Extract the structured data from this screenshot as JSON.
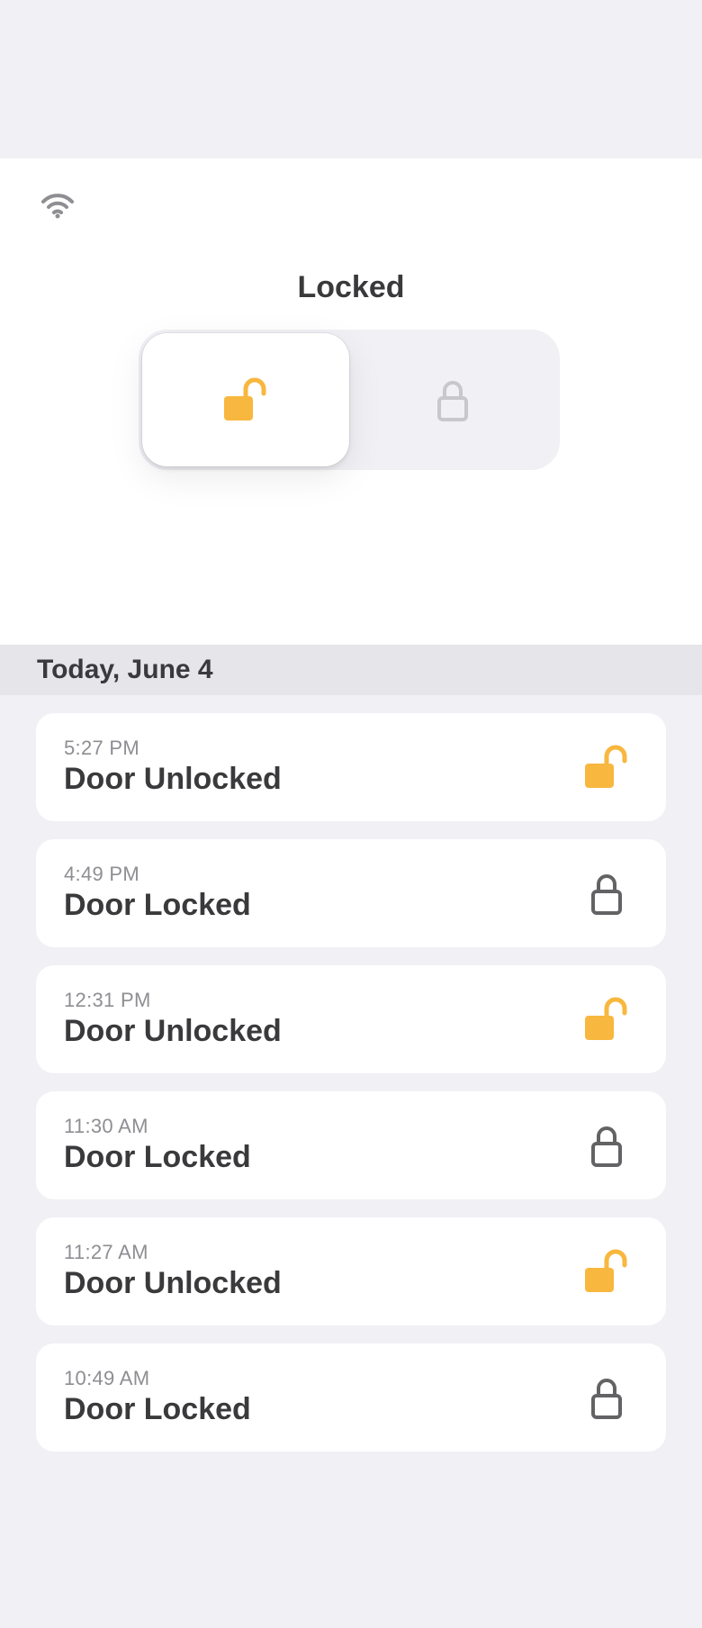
{
  "status": {
    "title": "Locked"
  },
  "toggle": {
    "unlock_icon": "unlocked-padlock-icon",
    "lock_icon": "locked-padlock-icon",
    "selected": "unlock"
  },
  "history": {
    "date_label": "Today, June 4",
    "events": [
      {
        "time": "5:27 PM",
        "label": "Door Unlocked",
        "state": "unlocked"
      },
      {
        "time": "4:49 PM",
        "label": "Door Locked",
        "state": "locked"
      },
      {
        "time": "12:31 PM",
        "label": "Door Unlocked",
        "state": "unlocked"
      },
      {
        "time": "11:30 AM",
        "label": "Door Locked",
        "state": "locked"
      },
      {
        "time": "11:27 AM",
        "label": "Door Unlocked",
        "state": "unlocked"
      },
      {
        "time": "10:49 AM",
        "label": "Door Locked",
        "state": "locked"
      }
    ]
  },
  "colors": {
    "accent_unlocked": "#f8b73e",
    "icon_locked": "#636366",
    "icon_inactive": "#c7c7cc",
    "wifi": "#8e8e93"
  }
}
